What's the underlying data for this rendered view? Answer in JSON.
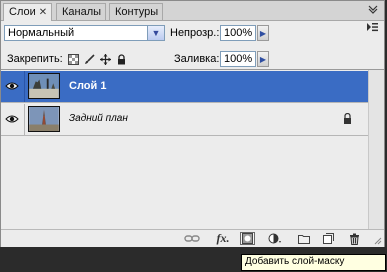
{
  "tabs": [
    {
      "label": "Слои",
      "close": "✕",
      "active": true
    },
    {
      "label": "Каналы",
      "active": false
    },
    {
      "label": "Контуры",
      "active": false
    }
  ],
  "blend_mode": {
    "value": "Нормальный"
  },
  "opacity": {
    "label": "Непрозр.:",
    "value": "100%"
  },
  "lock": {
    "label": "Закрепить:"
  },
  "fill": {
    "label": "Заливка:",
    "value": "100%"
  },
  "layers": [
    {
      "name": "Слой 1",
      "selected": true,
      "visible": true,
      "locked": false
    },
    {
      "name": "Задний план",
      "selected": false,
      "visible": true,
      "locked": true
    }
  ],
  "bottom_icons": [
    "link-layers-icon",
    "fx-icon",
    "add-mask-icon",
    "adjustment-layer-icon",
    "new-group-icon",
    "new-layer-icon",
    "trash-icon"
  ],
  "tooltip": "Добавить слой-маску",
  "colors": {
    "selected": "#3a6cc4",
    "panel": "#ececec",
    "tooltip_bg": "#ffffe1"
  }
}
